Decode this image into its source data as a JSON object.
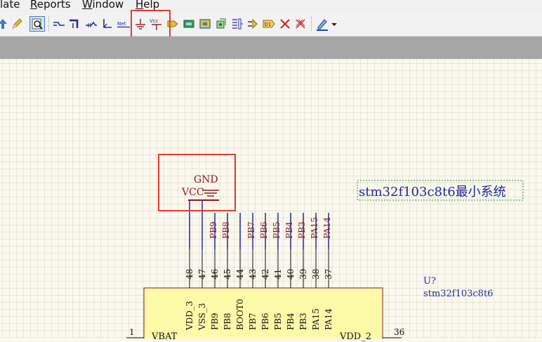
{
  "menu": {
    "items": [
      {
        "label": "late",
        "underline_first": false
      },
      {
        "label": "Reports",
        "underline_first": true
      },
      {
        "label": "Window",
        "underline_first": true
      },
      {
        "label": "Help",
        "underline_first": true
      }
    ]
  },
  "toolbar": {
    "buttons": [
      {
        "name": "move-up-icon"
      },
      {
        "name": "pencil-icon"
      },
      {
        "name": "inspect-icon",
        "pressed": true
      },
      {
        "name": "wire-icon"
      },
      {
        "name": "bus-icon"
      },
      {
        "name": "bus-entry-icon"
      },
      {
        "name": "net-label-tool-icon"
      },
      {
        "name": "net-label-icon",
        "text": "Net"
      },
      {
        "name": "gnd-port-icon"
      },
      {
        "name": "vcc-port-icon",
        "text": "Vcc"
      },
      {
        "name": "place-part-icon"
      },
      {
        "name": "sheet-symbol-icon"
      },
      {
        "name": "sheet-entry-icon"
      },
      {
        "name": "device-sheet-icon"
      },
      {
        "name": "port-icon"
      },
      {
        "name": "harness-icon"
      },
      {
        "name": "directive-icon",
        "text": "D1"
      },
      {
        "name": "no-erc-icon"
      },
      {
        "name": "compile-mask-icon"
      },
      {
        "name": "highlight-pen-icon"
      },
      {
        "name": "dropdown-arrow-icon"
      }
    ]
  },
  "schematic": {
    "title_text": "stm32f103c8t6最小系统",
    "power": {
      "gnd_label": "GND",
      "vcc_label": "VCC"
    },
    "component": {
      "designator": "U?",
      "comment": "stm32f103c8t6"
    },
    "net_labels": [
      "PB9",
      "PB8",
      "PB7",
      "PB6",
      "PB5",
      "PB4",
      "PB3",
      "PA15",
      "PA14"
    ],
    "pin_numbers": [
      "48",
      "47",
      "46",
      "45",
      "44",
      "43",
      "42",
      "41",
      "40",
      "39",
      "38",
      "37"
    ],
    "pin_names": [
      "VDD_3",
      "VSS_3",
      "PB9",
      "PB8",
      "BOOT0",
      "PB7",
      "PB6",
      "PB5",
      "PB4",
      "PB3",
      "PA15",
      "PA14"
    ],
    "left_pin_number": "1",
    "right_pin_number": "36",
    "left_pin_name": "VBAT",
    "right_pin_name": "VDD_2"
  },
  "colors": {
    "highlight_box": "#e53935",
    "wire": "#1b2a9a",
    "power": "#8b1a1a",
    "component_fill": "#fdfaa8",
    "title_text": "#1b2a9a"
  }
}
